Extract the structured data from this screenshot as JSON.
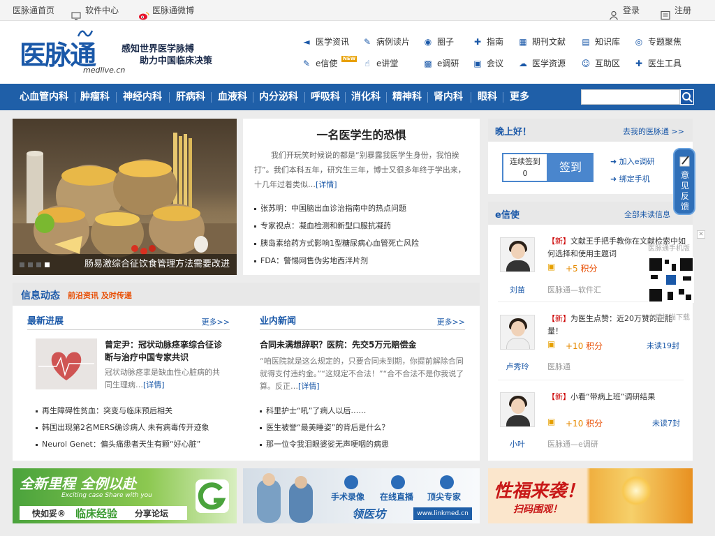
{
  "topbar": {
    "home": "医脉通首页",
    "software": "软件中心",
    "weibo": "医脉通微博",
    "login": "登录",
    "register": "注册"
  },
  "logo": {
    "text": "医脉通",
    "sub": "medlive.cn"
  },
  "slogan": {
    "line1": "感知世界医学脉搏",
    "line2": "助力中国临床决策"
  },
  "header_nav": {
    "row1": [
      "医学资讯",
      "病例读片",
      "圈子",
      "指南",
      "期刊文献",
      "知识库",
      "专题聚焦"
    ],
    "row2": [
      "e信使",
      "e讲堂",
      "e调研",
      "会议",
      "医学资源",
      "互助区",
      "医生工具"
    ],
    "new_badge": "NEW"
  },
  "categories": [
    "心血管内科",
    "肿瘤科",
    "神经内科",
    "肝病科",
    "血液科",
    "内分泌科",
    "呼吸科",
    "消化科",
    "精神科",
    "肾内科",
    "眼科",
    "更多"
  ],
  "search": {
    "placeholder": ""
  },
  "hero": {
    "caption": "肠易激综合征饮食管理方法需要改进"
  },
  "featured": {
    "title": "一名医学生的恐惧",
    "body": "我们开玩笑时候说的都是“别暴露我医学生身份，我怕挨打”。我们本科五年，研究生三年，博士又很多年终于学出来，十几年过着类似…",
    "detail": "[详情]",
    "list": [
      "张苏明：中国脑出血诊治指南中的热点问题",
      "专家视点：凝血检测和新型口服抗凝药",
      "胰岛素给药方式影响1型糖尿病心血管死亡风险",
      "FDA：警惕网售伪劣地西泮片剂"
    ]
  },
  "news": {
    "title": "信息动态",
    "subtitle": "前沿资讯 及时传递",
    "left": {
      "title": "最新进展",
      "more": "更多>>",
      "article_title": "曾定尹：冠状动脉痉挛综合征诊断与治疗中国专家共识",
      "article_body": "冠状动脉痉挛是缺血性心脏病的共同生理病…",
      "detail": "[详情]",
      "items": [
        "再生障碍性贫血：突变与临床预后相关",
        "韩国出现第2名MERS确诊病人 未有病毒传开迹象",
        "Neurol Genet：偏头痛患者天生有颗“好心脏”"
      ]
    },
    "right": {
      "title": "业内新闻",
      "more": "更多>>",
      "article_title": "合同未满想辞职？医院：先交5万元赔偿金",
      "article_body": "“咱医院就是这么规定的，只要合同未到期，你提前解除合同就得支付违约金。”“这规定不合法！”“合不合法不是你我说了算。反正…",
      "detail": "[详情]",
      "items": [
        "科里护士“吼”了病人以后……",
        "医生被誉“最美睡姿”的背后是什么？",
        "那一位令我泪眼婆娑无声哽咽的病患"
      ]
    }
  },
  "greeting": {
    "title": "晚上好！",
    "link": "去我的医脉通 >>",
    "sign_label": "连续签到",
    "sign_count": "0",
    "sign_button": "签到",
    "join": "加入e调研",
    "bind": "绑定手机"
  },
  "messenger": {
    "title": "e信使",
    "all_unread": "全部未读信息",
    "items": [
      {
        "tag": "【新】",
        "text": "文献王手把手教你在文献检索中如何选择和使用主题词",
        "points": "+5",
        "points_label": "积分",
        "user": "刘苗",
        "source": "医脉通—软件汇",
        "fans": ""
      },
      {
        "tag": "【新】",
        "text": "为医生点赞：近20万赞的正能量！",
        "points": "+10",
        "points_label": "积分",
        "user": "卢秀玲",
        "source": "医脉通",
        "fans": "未读19封"
      },
      {
        "tag": "【新】",
        "text": "小看“带病上班”调研结果",
        "points": "+10",
        "points_label": "积分",
        "user": "小叶",
        "source": "医脉通—e调研",
        "fans": "未读7封"
      }
    ]
  },
  "feedback": {
    "text": "意见反馈"
  },
  "qr": {
    "top": "医脉通手机版",
    "bottom": "立即扫描下载"
  },
  "banners": {
    "b1_line1": "全新里程 全例以赴",
    "b1_line2": "Exciting case Share with you",
    "b1_brand": "快如妥®",
    "b1_main": "临床经验",
    "b1_tail": "分享论坛",
    "b2_items": [
      "手术录像",
      "在线直播",
      "顶尖专家"
    ],
    "b2_brand": "领医坊",
    "b2_url": "www.linkmed.cn",
    "b3_main": "性福来袭！",
    "b3_sub": "扫码围观！"
  },
  "colors": {
    "primary": "#1f5fa8",
    "accent": "#e84c00",
    "link": "#1a58a8"
  }
}
